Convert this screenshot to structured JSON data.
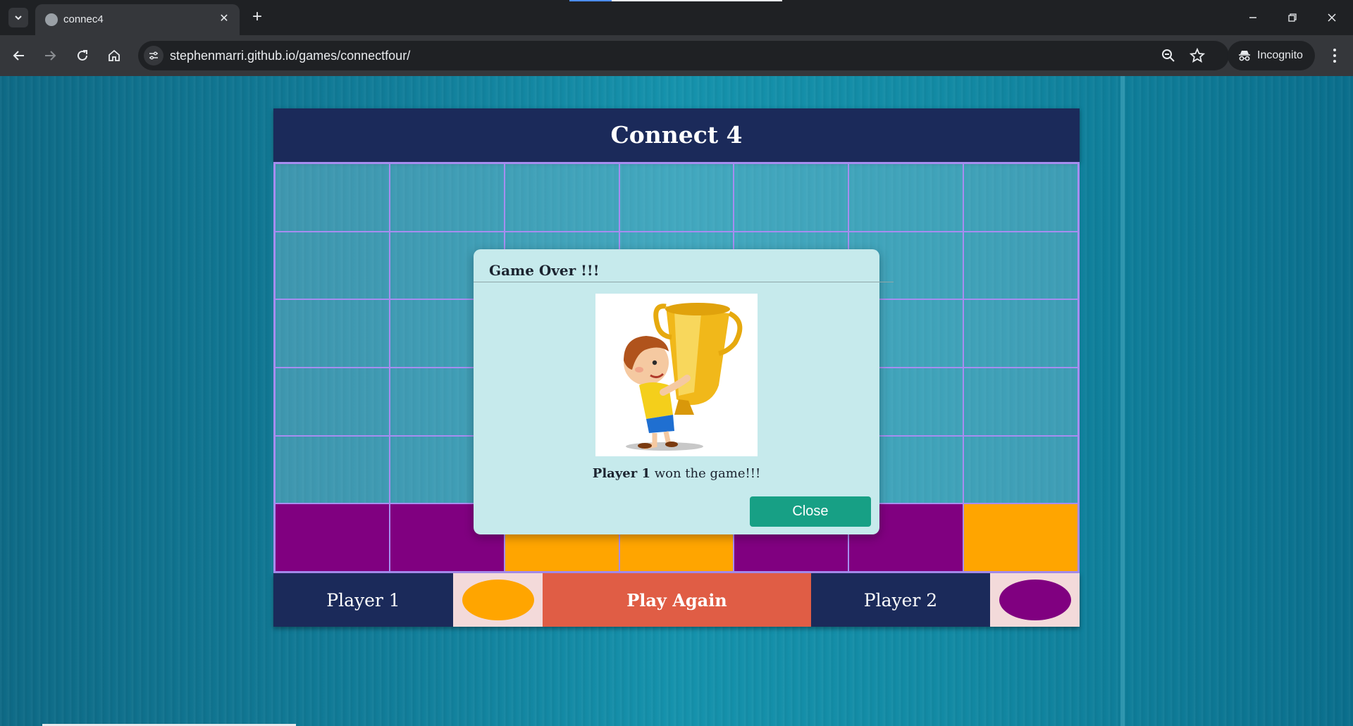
{
  "browser": {
    "tab_title": "connec4",
    "url": "stephenmarri.github.io/games/connectfour/",
    "incognito_label": "Incognito"
  },
  "game": {
    "title": "Connect 4",
    "board": [
      [
        "",
        "",
        "",
        "",
        "",
        "",
        ""
      ],
      [
        "",
        "",
        "",
        "",
        "",
        "",
        ""
      ],
      [
        "",
        "",
        "",
        "",
        "",
        "",
        ""
      ],
      [
        "",
        "",
        "",
        "",
        "",
        "",
        ""
      ],
      [
        "",
        "",
        "p",
        "o",
        "",
        "",
        ""
      ],
      [
        "p",
        "p",
        "o",
        "o",
        "p",
        "p",
        "o"
      ]
    ],
    "colors": {
      "player1": "#ffa500",
      "player2": "#800080",
      "header": "#1b2a5a",
      "play_again": "#e05d45"
    },
    "player1_label": "Player 1",
    "player2_label": "Player 2",
    "play_again_label": "Play Again"
  },
  "modal": {
    "title": "Game Over !!!",
    "winner": "Player 1",
    "message_rest": " won the game!!!",
    "close_label": "Close",
    "image_subject": "boy-holding-trophy"
  }
}
